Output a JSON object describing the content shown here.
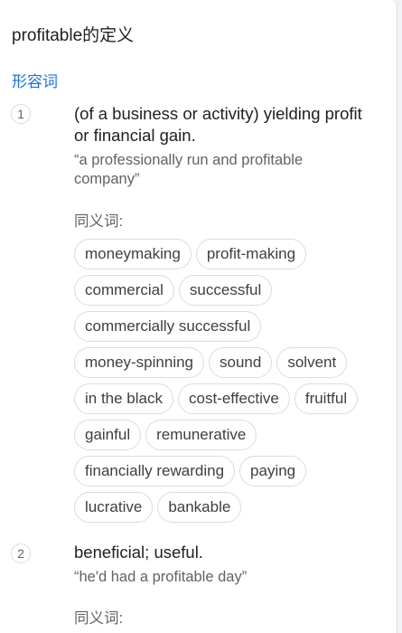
{
  "title": "profitable的定义",
  "part_of_speech": "形容词",
  "senses": [
    {
      "number": "1",
      "definition": "(of a business or activity) yielding profit or financial gain.",
      "example": "“a professionally run and profitable company”",
      "synonyms_label": "同义词:",
      "synonym_rows": [
        [
          "moneymaking",
          "profit-making"
        ],
        [
          "commercial",
          "successful"
        ],
        [
          "commercially successful"
        ],
        [
          "money-spinning",
          "sound",
          "solvent"
        ],
        [
          "in the black",
          "cost-effective",
          "fruitful"
        ],
        [
          "gainful",
          "remunerative"
        ],
        [
          "financially rewarding",
          "paying"
        ],
        [
          "lucrative",
          "bankable"
        ]
      ]
    },
    {
      "number": "2",
      "definition": "beneficial; useful.",
      "example": "“he'd had a profitable day”",
      "synonyms_label": "同义词:"
    }
  ]
}
